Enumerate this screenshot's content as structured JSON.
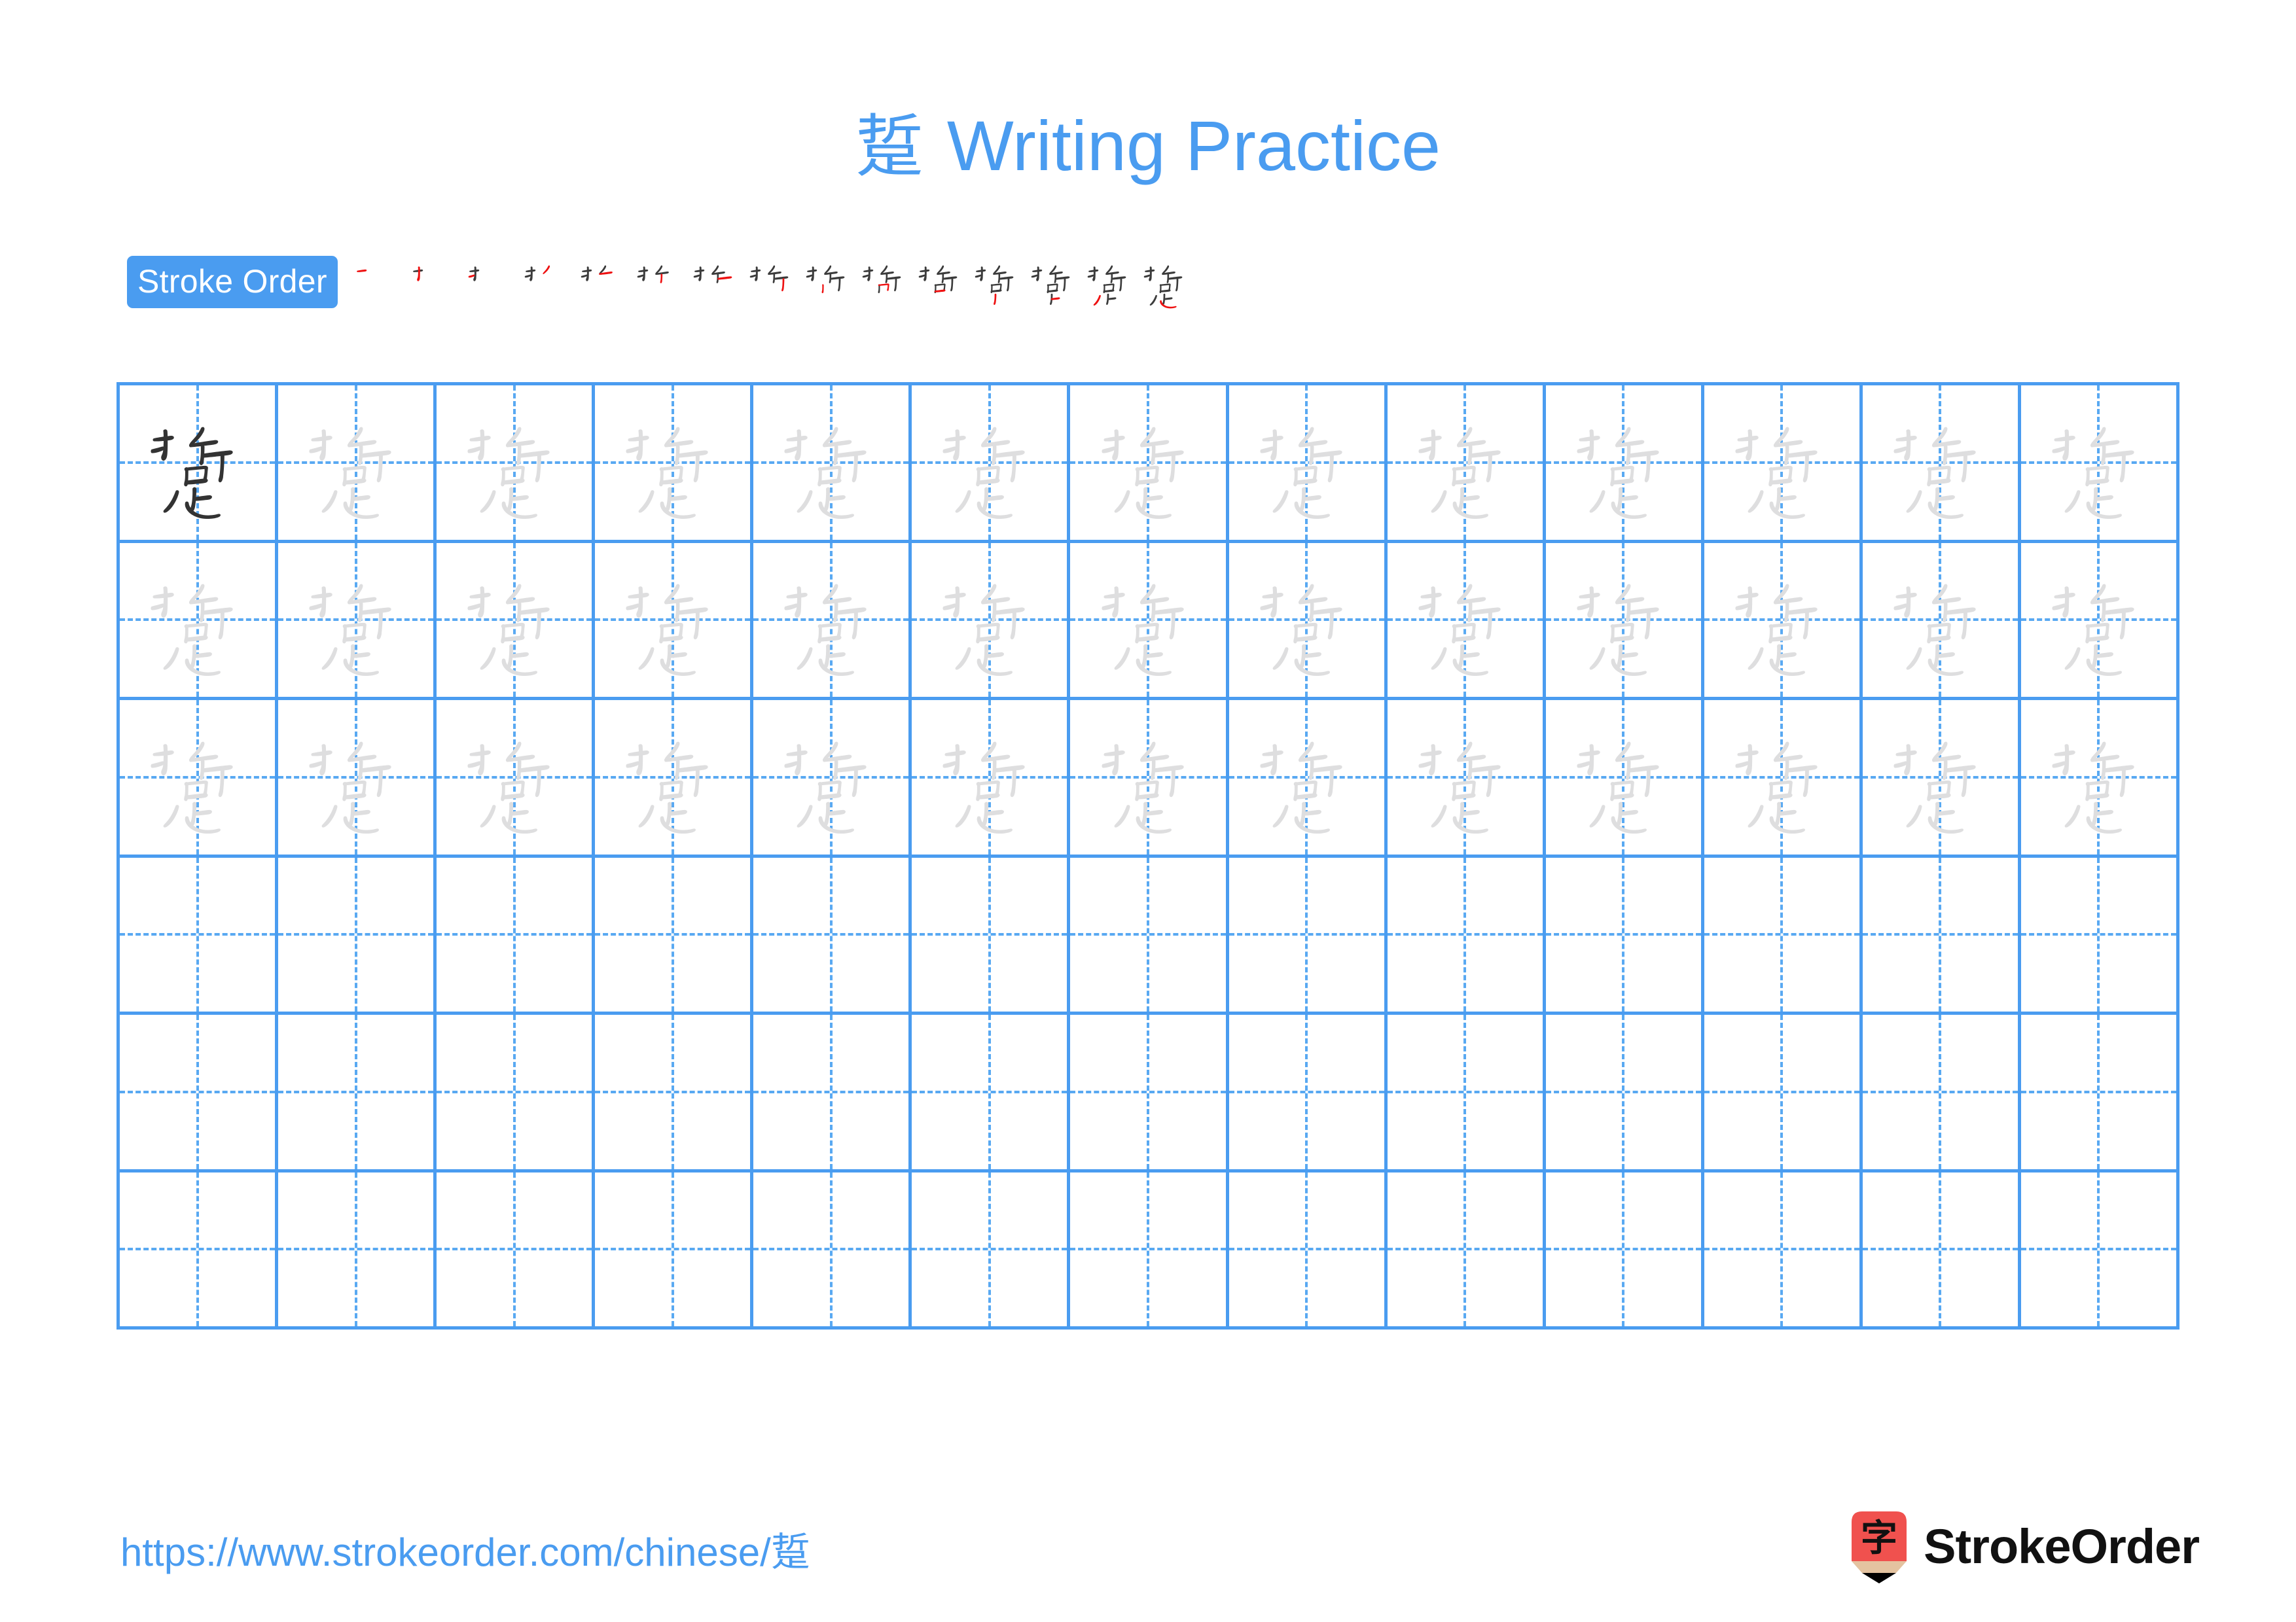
{
  "character": "踅",
  "title": {
    "character": "踅",
    "suffix": " Writing Practice",
    "color": "#4a9cf0"
  },
  "stroke_order": {
    "badge_label": "Stroke Order",
    "badge_bg": "#4a9cf0",
    "badge_text_color": "#ffffff",
    "existing_stroke_color": "#3b3b3b",
    "new_stroke_color": "#ee1111",
    "total_strokes": 15,
    "steps": [
      {
        "index": 1,
        "strokes_shown": 1,
        "new_stroke": 1
      },
      {
        "index": 2,
        "strokes_shown": 2,
        "new_stroke": 2
      },
      {
        "index": 3,
        "strokes_shown": 3,
        "new_stroke": 3
      },
      {
        "index": 4,
        "strokes_shown": 4,
        "new_stroke": 4
      },
      {
        "index": 5,
        "strokes_shown": 5,
        "new_stroke": 5
      },
      {
        "index": 6,
        "strokes_shown": 6,
        "new_stroke": 6
      },
      {
        "index": 7,
        "strokes_shown": 7,
        "new_stroke": 7
      },
      {
        "index": 8,
        "strokes_shown": 8,
        "new_stroke": 8
      },
      {
        "index": 9,
        "strokes_shown": 9,
        "new_stroke": 9
      },
      {
        "index": 10,
        "strokes_shown": 10,
        "new_stroke": 10
      },
      {
        "index": 11,
        "strokes_shown": 11,
        "new_stroke": 11
      },
      {
        "index": 12,
        "strokes_shown": 12,
        "new_stroke": 12
      },
      {
        "index": 13,
        "strokes_shown": 13,
        "new_stroke": 13
      },
      {
        "index": 14,
        "strokes_shown": 14,
        "new_stroke": 14
      },
      {
        "index": 15,
        "strokes_shown": 15,
        "new_stroke": 15
      }
    ]
  },
  "practice_grid": {
    "columns": 13,
    "rows": 6,
    "line_color": "#4a9cf0",
    "guide_color": "#59a9f2",
    "dark_glyph_color": "#333333",
    "light_glyph_color": "#dededf",
    "row_fill": [
      {
        "row": 1,
        "filled_cells": 13,
        "first_cell_dark": true
      },
      {
        "row": 2,
        "filled_cells": 13,
        "first_cell_dark": false
      },
      {
        "row": 3,
        "filled_cells": 13,
        "first_cell_dark": false
      },
      {
        "row": 4,
        "filled_cells": 0,
        "first_cell_dark": false
      },
      {
        "row": 5,
        "filled_cells": 0,
        "first_cell_dark": false
      },
      {
        "row": 6,
        "filled_cells": 0,
        "first_cell_dark": false
      }
    ]
  },
  "footer": {
    "url": "https://www.strokeorder.com/chinese/踅",
    "url_color": "#4a9cf0",
    "brand_name": "StrokeOrder",
    "brand_icon_character": "字",
    "brand_icon_body_color": "#f0514e",
    "brand_icon_wood_color": "#e4c3a0",
    "brand_icon_tip_color": "#000000"
  }
}
